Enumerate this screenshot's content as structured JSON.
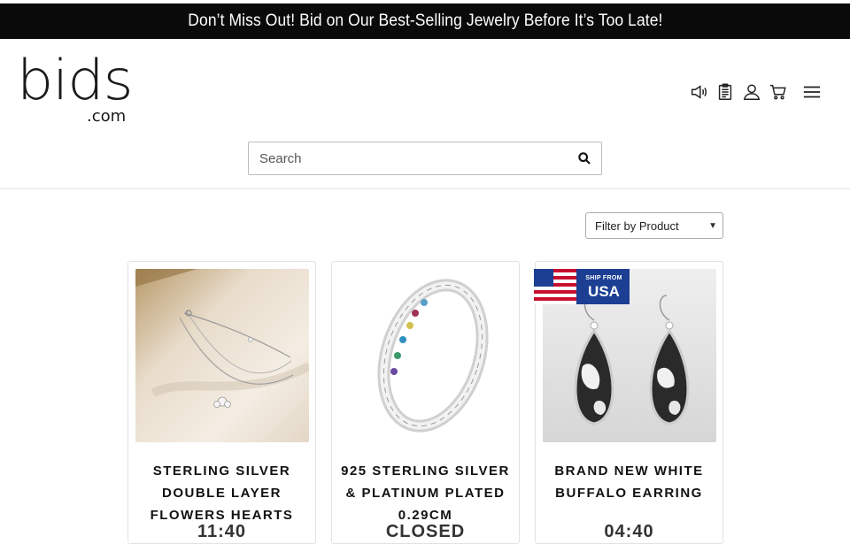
{
  "banner": {
    "text": "Don’t Miss Out! Bid on Our Best-Selling Jewelry Before It’s Too Late!"
  },
  "logo": {
    "main": "bids",
    "sub": ".com"
  },
  "header_icons": [
    "megaphone-icon",
    "clipboard-icon",
    "user-icon",
    "cart-icon",
    "menu-icon"
  ],
  "search": {
    "placeholder": "Search",
    "value": ""
  },
  "filter": {
    "selected": "Filter by Product"
  },
  "products": [
    {
      "title": "Sterling Silver Double Layer Flowers Hearts",
      "status": "11:40"
    },
    {
      "title": "925 Sterling Silver & Platinum Plated 0.29cm",
      "status": "CLOSED"
    },
    {
      "title": "Brand New White Buffalo Earring",
      "status": "04:40",
      "badge": {
        "line1": "SHIP FROM",
        "line2": "USA"
      }
    }
  ],
  "colors": {
    "banner_bg": "#0a0a0a",
    "banner_text": "#ffffff",
    "badge_blue": "#1c3f94",
    "flag_red": "#c8102e"
  }
}
